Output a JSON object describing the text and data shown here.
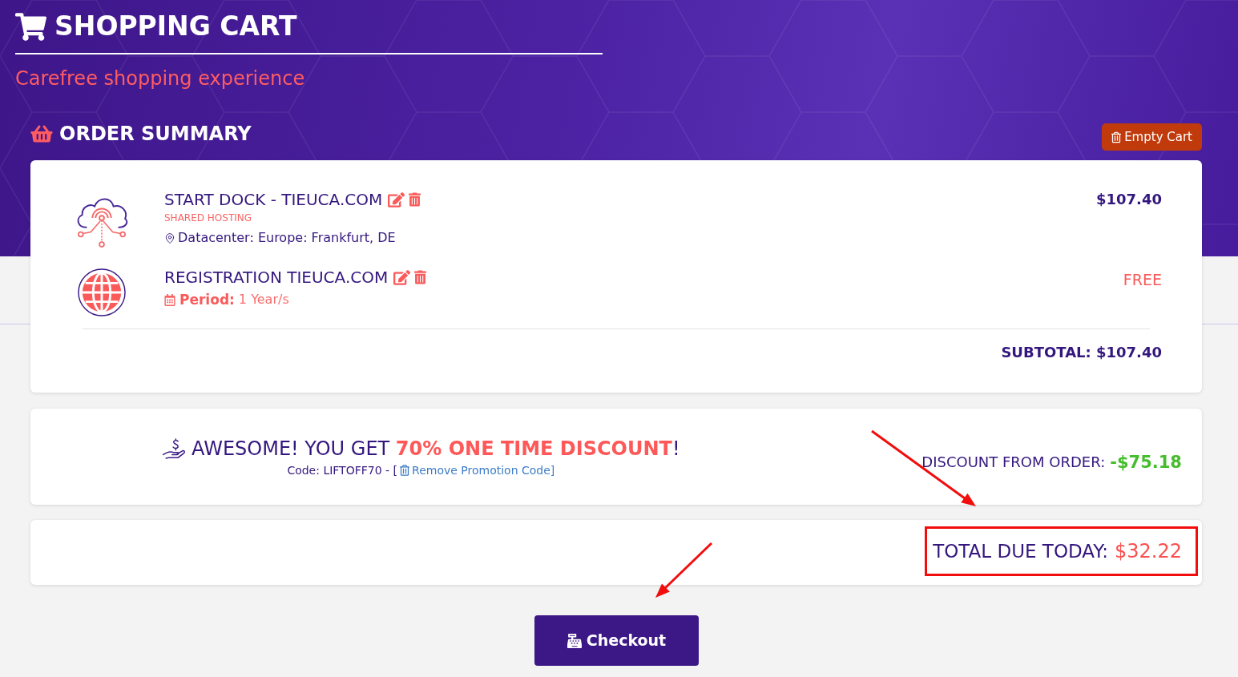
{
  "header": {
    "title": "SHOPPING CART",
    "subtitle": "Carefree shopping experience"
  },
  "order_summary": {
    "title": "ORDER SUMMARY",
    "empty_cart_button": "Empty Cart"
  },
  "items": [
    {
      "kind": "hosting",
      "title": "START DOCK - TIEUCA.COM",
      "category": "SHARED HOSTING",
      "location": "Datacenter: Europe: Frankfurt, DE",
      "price": "$107.40"
    },
    {
      "kind": "domain",
      "title": "REGISTRATION TIEUCA.COM",
      "period_label": "Period:",
      "period_value": "1 Year/s",
      "price": "FREE"
    }
  ],
  "subtotal": "SUBTOTAL: $107.40",
  "promotion": {
    "message": "AWESOME! YOU GET **70% ONE TIME DISCOUNT**!",
    "code": "Code: LIFTOFF70 - [",
    "remove_link": "Remove Promotion Code]",
    "discount_label": "DISCOUNT FROM ORDER:",
    "discount_value": "-$75.18"
  },
  "total": {
    "label": "TOTAL DUE TODAY:",
    "value": "$32.22",
    "highlighted": true,
    "pointed_at": true
  },
  "checkout_button": {
    "label": "Checkout",
    "pointed_at": true
  }
}
